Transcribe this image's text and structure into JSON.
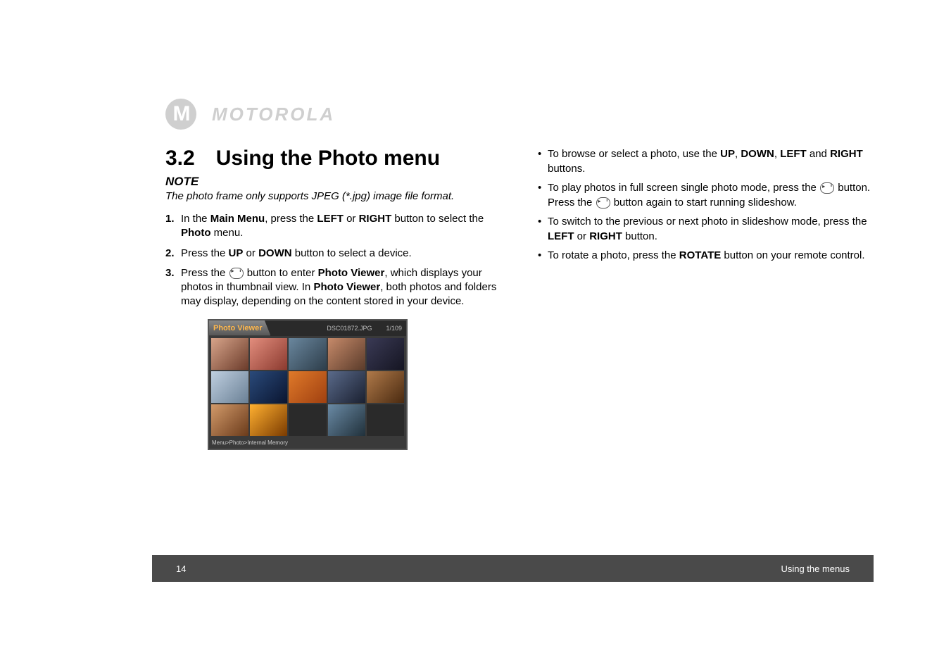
{
  "brand": "MOTOROLA",
  "section": {
    "num": "3.2",
    "title": "Using the Photo menu"
  },
  "note": {
    "label": "NOTE",
    "text": "The photo frame only supports JPEG (*.jpg) image file format."
  },
  "steps": [
    {
      "n": "1.",
      "pre": "In the ",
      "b1": "Main Menu",
      "mid1": ", press the ",
      "b2": "LEFT",
      "mid2": " or ",
      "b3": "RIGHT",
      "post": " button to select the ",
      "ui": "Photo",
      "end": " menu."
    },
    {
      "n": "2.",
      "pre": "Press the ",
      "b1": "UP",
      "mid1": " or ",
      "b2": "DOWN",
      "post": " button to select a device."
    },
    {
      "n": "3.",
      "pre": "Press the ",
      "post_icon": " button to enter ",
      "ui": "Photo Viewer",
      "mid1": ", which displays your photos in thumbnail view. In ",
      "ui2": "Photo Viewer",
      "end": ", both photos and folders may display, depending on the content stored in your device."
    }
  ],
  "viewer": {
    "title": "Photo Viewer",
    "filename": "DSC01872.JPG",
    "counter": "1/109",
    "breadcrumb": "Menu>Photo>Internal Memory"
  },
  "bullets": [
    {
      "pre": "To browse or select a photo, use the ",
      "b1": "UP",
      "s1": ", ",
      "b2": "DOWN",
      "s2": ", ",
      "b3": "LEFT",
      "s3": " and ",
      "b4": "RIGHT",
      "end": " buttons."
    },
    {
      "pre": "To play photos in full screen single photo mode, press the ",
      "icon1": true,
      "mid": " button. Press the ",
      "icon2": true,
      "end": " button again to start running slideshow."
    },
    {
      "pre": "To switch to the previous or next photo in slideshow mode, press the ",
      "b1": "LEFT",
      "s1": " or ",
      "b2": "RIGHT",
      "end": " button."
    },
    {
      "pre": "To rotate a photo, press the ",
      "b1": "ROTATE",
      "end": " button on your remote control."
    }
  ],
  "footer": {
    "page": "14",
    "section": "Using the menus"
  }
}
